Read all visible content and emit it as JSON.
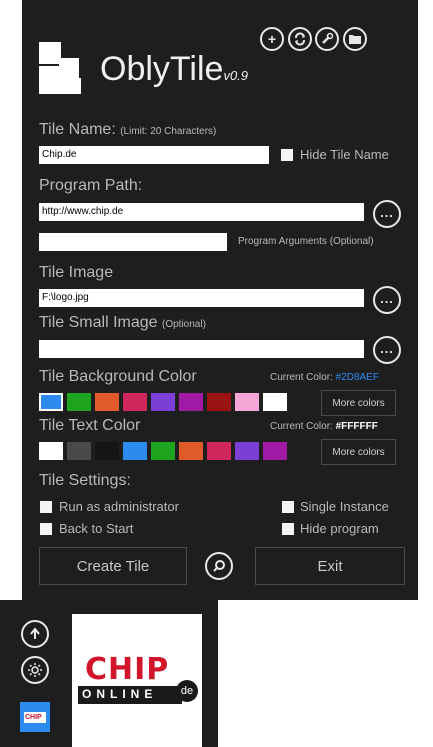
{
  "header": {
    "title": "OblyTile",
    "version": "v0.9",
    "icons": [
      "plus-icon",
      "refresh-icon",
      "wrench-icon",
      "folder-icon"
    ]
  },
  "tile_name": {
    "label": "Tile Name:",
    "limit_note": "(Limit: 20 Characters)",
    "value": "Chip.de",
    "hide_label": "Hide Tile Name"
  },
  "program_path": {
    "label": "Program Path:",
    "value": "http://www.chip.de",
    "arguments_value": "",
    "arguments_label": "Program Arguments (Optional)"
  },
  "tile_image": {
    "label": "Tile Image",
    "value": "F:\\logo.jpg"
  },
  "tile_small_image": {
    "label": "Tile Small Image",
    "optional_note": "(Optional)",
    "value": ""
  },
  "bg_color": {
    "label": "Tile Background Color",
    "current_label": "Current Color:",
    "current_value": "#2D8AEF",
    "swatches": [
      "#2d8aef",
      "#1ea41e",
      "#e05a2a",
      "#d1265c",
      "#7b3fd6",
      "#a11aa6",
      "#9a1414",
      "#f6a6d6",
      "#ffffff"
    ],
    "more_label": "More colors"
  },
  "text_color": {
    "label": "Tile Text Color",
    "current_label": "Current Color:",
    "current_value": "#FFFFFF",
    "swatches": [
      "#ffffff",
      "#4a4a4a",
      "#151515",
      "#2d8aef",
      "#1ea41e",
      "#e05a2a",
      "#d1265c",
      "#7b3fd6",
      "#a11aa6"
    ],
    "more_label": "More colors"
  },
  "settings": {
    "label": "Tile Settings:",
    "run_admin": "Run as administrator",
    "single_instance": "Single Instance",
    "back_to_start": "Back to Start",
    "hide_program": "Hide program"
  },
  "actions": {
    "create": "Create Tile",
    "exit": "Exit"
  },
  "preview": {
    "logo_text": "CHIP",
    "logo_sub": "ONLINE",
    "logo_badge": "de",
    "small_logo_text": "CHIP"
  },
  "colors": {
    "background": "#1e1e1e",
    "accent": "#2d8aef"
  }
}
